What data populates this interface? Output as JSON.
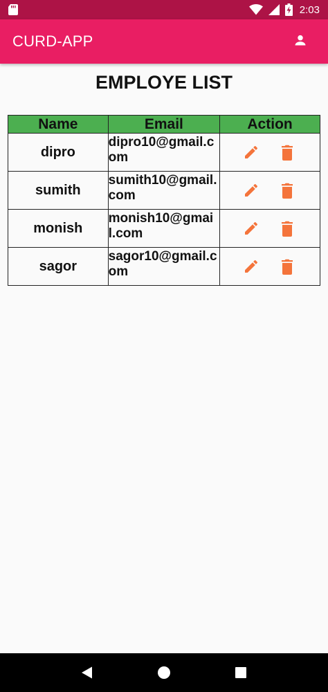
{
  "status_bar": {
    "time": "2:03",
    "icons": [
      "sd-card-icon",
      "wifi-icon",
      "signal-icon",
      "battery-charging-icon"
    ]
  },
  "app_bar": {
    "title": "CURD-APP",
    "action_icon": "person-icon"
  },
  "page": {
    "title": "EMPLOYE LIST"
  },
  "table": {
    "headers": [
      "Name",
      "Email",
      "Action"
    ],
    "rows": [
      {
        "name": "dipro",
        "email": "dipro10@gmail.com"
      },
      {
        "name": "sumith",
        "email": "sumith10@gmail.com"
      },
      {
        "name": "monish",
        "email": "monish10@gmail.com"
      },
      {
        "name": "sagor",
        "email": "sagor10@gmail.com"
      }
    ],
    "action_icons": [
      "pencil-icon",
      "trash-icon"
    ],
    "header_color": "#4caf50",
    "action_icon_color": "#f4743b"
  },
  "nav_bar": {
    "icons": [
      "back-icon",
      "home-icon",
      "recents-icon"
    ]
  },
  "colors": {
    "primary": "#e91e63",
    "primary_dark": "#ad1346"
  }
}
